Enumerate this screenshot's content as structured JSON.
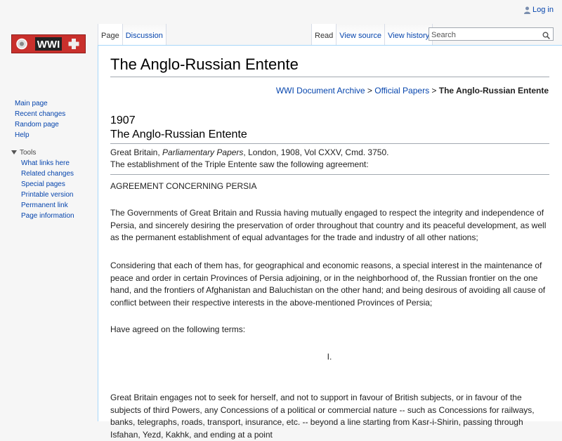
{
  "personal": {
    "login_label": "Log in"
  },
  "logo": {
    "text": "WWI"
  },
  "tabs": {
    "left": [
      {
        "label": "Page"
      },
      {
        "label": "Discussion"
      }
    ],
    "right": [
      {
        "label": "Read"
      },
      {
        "label": "View source"
      },
      {
        "label": "View history"
      }
    ]
  },
  "search": {
    "placeholder": "Search"
  },
  "sidebar": {
    "navigation": [
      {
        "label": "Main page"
      },
      {
        "label": "Recent changes"
      },
      {
        "label": "Random page"
      },
      {
        "label": "Help"
      }
    ],
    "tools_heading": "Tools",
    "tools": [
      {
        "label": "What links here"
      },
      {
        "label": "Related changes"
      },
      {
        "label": "Special pages"
      },
      {
        "label": "Printable version"
      },
      {
        "label": "Permanent link"
      },
      {
        "label": "Page information"
      }
    ]
  },
  "page": {
    "title": "The Anglo-Russian Entente",
    "breadcrumb": {
      "items": [
        "WWI Document Archive",
        "Official Papers"
      ],
      "separator": ">",
      "current": "The Anglo-Russian Entente"
    },
    "doc_year": "1907",
    "doc_title": "The Anglo-Russian Entente",
    "citation": {
      "source_prefix": "Great Britain, ",
      "source_italic": "Parliamentary Papers",
      "source_suffix": ", London, 1908, Vol CXXV, Cmd. 3750.",
      "intro": "The establishment of the Triple Entente saw the following agreement:"
    },
    "body": {
      "heading": "AGREEMENT CONCERNING PERSIA",
      "p1": "The Governments of Great Britain and Russia having mutually engaged to respect the integrity and independence of Persia, and sincerely desiring the preservation of order throughout that country and its peaceful development, as well as the permanent establishment of equal advantages for the trade and industry of all other nations;",
      "p2": "Considering that each of them has, for geographical and economic reasons, a special interest in the maintenance of peace and order in certain Provinces of Persia adjoining, or in the neighborhood of, the Russian frontier on the one hand, and the frontiers of Afghanistan and Baluchistan on the other hand; and being desirous of avoiding all cause of conflict between their respective interests in the above-mentioned Provinces of Persia;",
      "p3": "Have agreed on the following terms:",
      "article_number": "I.",
      "p4": "Great Britain engages not to seek for herself, and not to support in favour of British subjects, or in favour of the subjects of third Powers, any Concessions of a political or commercial nature -- such as Concessions for railways, banks, telegraphs, roads, transport, insurance, etc. -- beyond a line starting from Kasr-i-Shirin, passing through Isfahan, Yezd, Kakhk, and ending at a point"
    }
  }
}
